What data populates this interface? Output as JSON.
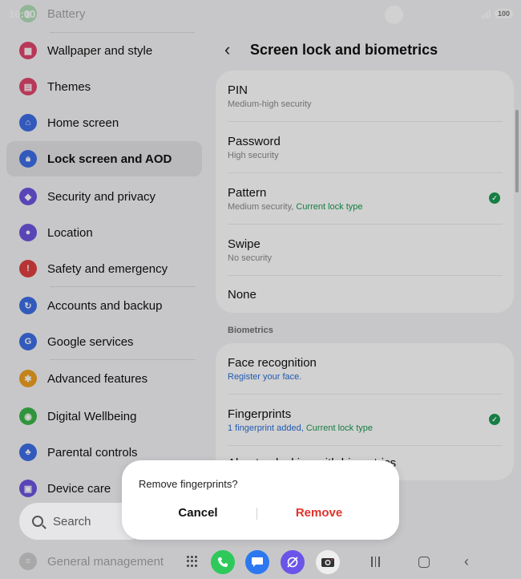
{
  "status": {
    "time": "10:00",
    "battery": "100"
  },
  "left_menu": {
    "items": [
      {
        "label": "Battery",
        "color": "#3bb54a",
        "icon": "battery-icon"
      },
      {
        "label": "Wallpaper and style",
        "color": "#e0456d",
        "icon": "wallpaper-icon"
      },
      {
        "label": "Themes",
        "color": "#e0456d",
        "icon": "themes-icon"
      },
      {
        "label": "Home screen",
        "color": "#3d6ee6",
        "icon": "home-icon"
      },
      {
        "label": "Lock screen and AOD",
        "color": "#3d6ee6",
        "icon": "lock-icon"
      },
      {
        "label": "Security and privacy",
        "color": "#6d55e0",
        "icon": "shield-icon"
      },
      {
        "label": "Location",
        "color": "#6d55e0",
        "icon": "location-pin-icon"
      },
      {
        "label": "Safety and emergency",
        "color": "#e04040",
        "icon": "emergency-icon"
      },
      {
        "label": "Accounts and backup",
        "color": "#3d6ee6",
        "icon": "sync-icon"
      },
      {
        "label": "Google services",
        "color": "#3d6ee6",
        "icon": "google-icon"
      },
      {
        "label": "Advanced features",
        "color": "#f0a020",
        "icon": "gear-plus-icon"
      },
      {
        "label": "Digital Wellbeing",
        "color": "#3bb54a",
        "icon": "wellbeing-icon"
      },
      {
        "label": "Parental controls",
        "color": "#3d6ee6",
        "icon": "parental-icon"
      },
      {
        "label": "Device care",
        "color": "#6d55e0",
        "icon": "device-care-icon"
      },
      {
        "label": "General management",
        "color": "#888888",
        "icon": "general-management-icon"
      }
    ]
  },
  "search": {
    "label": "Search"
  },
  "header": {
    "title": "Screen lock and biometrics"
  },
  "lock_types": [
    {
      "title": "PIN",
      "sub": "Medium-high security"
    },
    {
      "title": "Password",
      "sub": "High security"
    },
    {
      "title": "Pattern",
      "sub": "Medium security, ",
      "sub_extra": "Current lock type"
    },
    {
      "title": "Swipe",
      "sub": "No security"
    },
    {
      "title": "None"
    }
  ],
  "biometrics": {
    "section_label": "Biometrics",
    "items": [
      {
        "title": "Face recognition",
        "sub": "Register your face."
      },
      {
        "title": "Fingerprints",
        "sub": "1 fingerprint added, ",
        "sub_extra": "Current lock type"
      },
      {
        "title": "About unlocking with biometrics"
      }
    ]
  },
  "dialog": {
    "message": "Remove fingerprints?",
    "cancel": "Cancel",
    "remove": "Remove"
  },
  "colors": {
    "accent_green": "#1a9a52",
    "link_blue": "#2a6fd6",
    "destructive_red": "#e0322c"
  }
}
